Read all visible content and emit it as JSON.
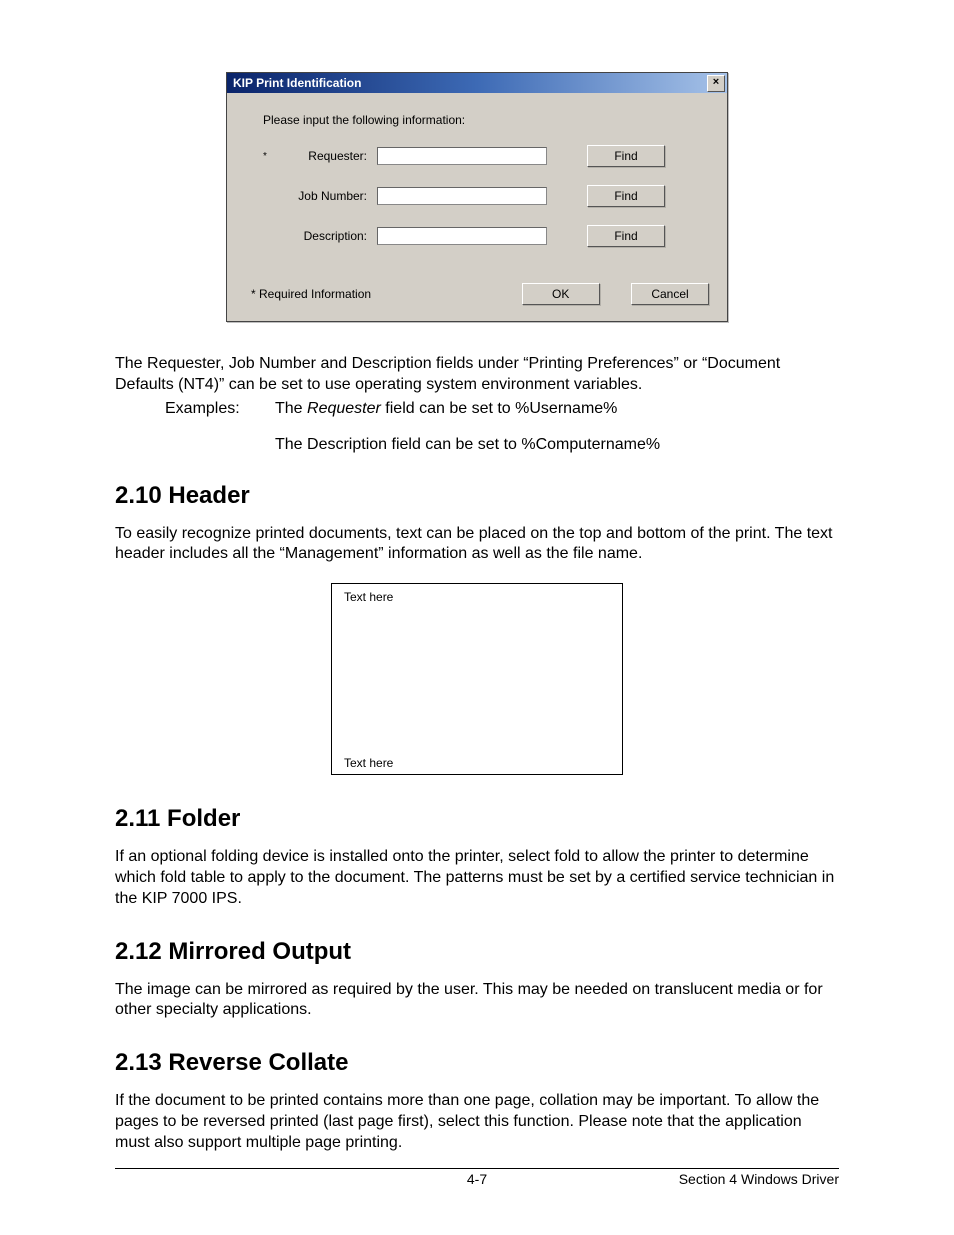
{
  "dialog": {
    "title": "KIP Print Identification",
    "close_glyph": "×",
    "instruction": "Please input the following information:",
    "rows": [
      {
        "required": true,
        "label": "Requester:",
        "find": "Find"
      },
      {
        "required": false,
        "label": "Job Number:",
        "find": "Find"
      },
      {
        "required": false,
        "label": "Description:",
        "find": "Find"
      }
    ],
    "required_note": "* Required Information",
    "ok_label": "OK",
    "cancel_label": "Cancel"
  },
  "body": {
    "p1a": "The Requester, Job Number and Description fields under “Printing Preferences” or “Document Defaults (NT4)” can be set to use operating system environment variables.",
    "examples_label": "Examples:",
    "ex1_prefix": "The ",
    "ex1_italic": "Requester",
    "ex1_suffix": " field can be set to %Username%",
    "ex2": "The Description field can be set to %Computername%"
  },
  "s210": {
    "heading": "2.10 Header",
    "para": "To easily recognize printed documents, text can be placed on the top and bottom of the print. The text header includes all the “Management” information as well as the file name.",
    "diagram_top": "Text  here",
    "diagram_bottom": "Text here"
  },
  "s211": {
    "heading": "2.11 Folder",
    "para": "If an optional folding device is installed onto the printer, select fold to allow the printer to determine which fold table to apply to the document. The patterns must be set by a certified service technician in the KIP 7000 IPS."
  },
  "s212": {
    "heading": "2.12 Mirrored Output",
    "para": "The image can be mirrored as required by the user. This may be needed on translucent media or for other specialty applications."
  },
  "s213": {
    "heading": "2.13 Reverse Collate",
    "para": "If the document to be printed contains more than one page, collation may be important. To allow the pages to be reversed printed (last page first), select this function. Please note that the application must also support multiple page printing."
  },
  "footer": {
    "center": "4-7",
    "right": "Section 4    Windows Driver"
  }
}
